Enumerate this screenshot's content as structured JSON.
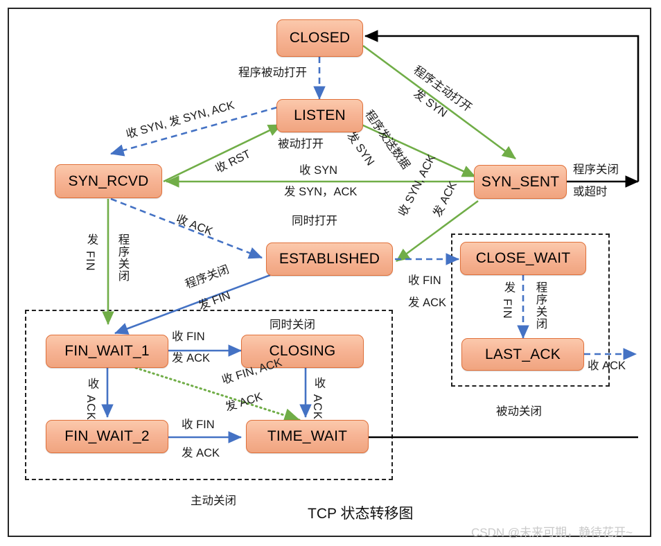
{
  "diagram": {
    "title": "TCP 状态转移图",
    "watermark": "CSDN @未来可期，静待花开~",
    "accent_node_fill": "#f4b08d",
    "accent_node_border": "#e0703a",
    "green_edge": "#70ad47",
    "blue_edge": "#4472c4",
    "dark_edge": "#000000"
  },
  "nodes": {
    "closed": "CLOSED",
    "listen": "LISTEN",
    "syn_rcvd": "SYN_RCVD",
    "syn_sent": "SYN_SENT",
    "established": "ESTABLISHED",
    "close_wait": "CLOSE_WAIT",
    "last_ack": "LAST_ACK",
    "fin_wait_1": "FIN_WAIT_1",
    "fin_wait_2": "FIN_WAIT_2",
    "closing": "CLOSING",
    "time_wait": "TIME_WAIT"
  },
  "group_labels": {
    "listen_caption": "被动打开",
    "simultaneous_open": "同时打开",
    "simultaneous_close": "同时关闭",
    "active_close": "主动关闭",
    "passive_close": "被动关闭"
  },
  "edge_labels": {
    "closed_to_listen": "程序被动打开",
    "closed_to_syn_sent_1": "程序主动打开",
    "closed_to_syn_sent_2": "发 SYN",
    "listen_to_syn_rcvd_1": "收 SYN, 发 SYN, ACK",
    "syn_rcvd_to_listen": "收 RST",
    "listen_to_syn_sent_1": "程序发送数据",
    "listen_to_syn_sent_2": "发 SYN",
    "syn_sent_to_syn_rcvd_1": "收 SYN",
    "syn_sent_to_syn_rcvd_2": "发 SYN，ACK",
    "syn_rcvd_to_established": "收 ACK",
    "syn_sent_to_established_1": "收 SYN, ACK",
    "syn_sent_to_established_2": "发 ACK",
    "syn_sent_close_1": "程序关闭",
    "syn_sent_close_2": "或超时",
    "syn_rcvd_to_fw1_1": "发",
    "syn_rcvd_to_fw1_2": "FIN",
    "syn_rcvd_to_fw1_3": "程",
    "syn_rcvd_to_fw1_4": "序",
    "syn_rcvd_to_fw1_5": "关",
    "syn_rcvd_to_fw1_6": "闭",
    "established_to_fw1_1": "程序关闭",
    "established_to_fw1_2": "发 FIN",
    "established_to_close_wait_1": "收 FIN",
    "established_to_close_wait_2": "发 ACK",
    "close_wait_to_last_ack_1": "发",
    "close_wait_to_last_ack_2": "FIN",
    "close_wait_to_last_ack_3": "程序关闭",
    "last_ack_to_closed": "收 ACK",
    "fw1_to_closing_1": "收 FIN",
    "fw1_to_closing_2": "发 ACK",
    "fw1_to_fw2_1": "收",
    "fw1_to_fw2_2": "ACK",
    "fw1_to_time_wait_1": "收 FIN,  ACK",
    "fw1_to_time_wait_2": "发 ACK",
    "closing_to_time_wait_1": "收",
    "closing_to_time_wait_2": "ACK",
    "fw2_to_time_wait_1": "收 FIN",
    "fw2_to_time_wait_2": "发 ACK"
  }
}
